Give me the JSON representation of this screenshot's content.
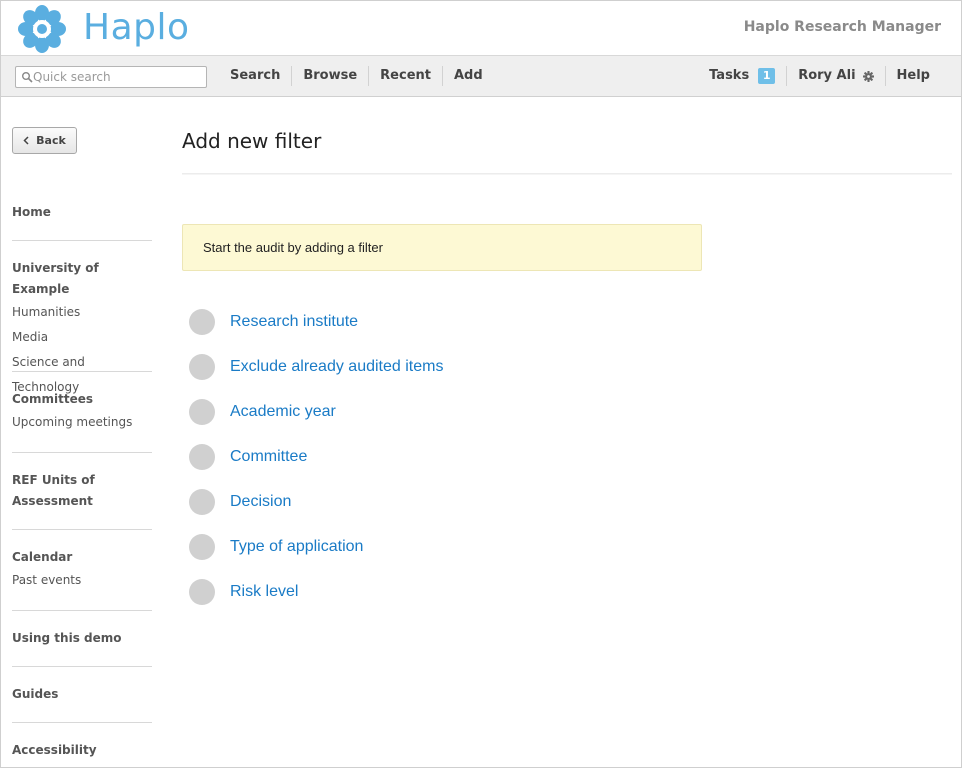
{
  "app": {
    "logo_text": "Haplo",
    "product_name": "Haplo Research Manager"
  },
  "search": {
    "placeholder": "Quick search",
    "value": ""
  },
  "nav": {
    "left": [
      "Search",
      "Browse",
      "Recent",
      "Add"
    ],
    "tasks_label": "Tasks",
    "tasks_count": "1",
    "user_name": "Rory Ali",
    "help_label": "Help"
  },
  "sidebar": {
    "back_label": "Back",
    "sections": [
      {
        "heading": "Home",
        "links": []
      },
      {
        "heading": "University of Example",
        "links": [
          "Humanities",
          "Media",
          "Science and Technology"
        ]
      },
      {
        "heading": "Committees",
        "links": [
          "Upcoming meetings"
        ]
      },
      {
        "heading": "REF Units of Assessment",
        "links": []
      },
      {
        "heading": "Calendar",
        "links": [
          "Past events"
        ]
      },
      {
        "heading": "Using this demo",
        "links": []
      },
      {
        "heading": "Guides",
        "links": []
      },
      {
        "heading": "Accessibility",
        "links": []
      }
    ]
  },
  "main": {
    "title": "Add new filter",
    "notice": "Start the audit by adding a filter",
    "filters": [
      "Research institute",
      "Exclude already audited items",
      "Academic year",
      "Committee",
      "Decision",
      "Type of application",
      "Risk level"
    ]
  },
  "colors": {
    "brand": "#5aaee0",
    "link": "#1a7bc6",
    "notice_bg": "#fdf9d4",
    "badge": "#6fbfe8"
  }
}
